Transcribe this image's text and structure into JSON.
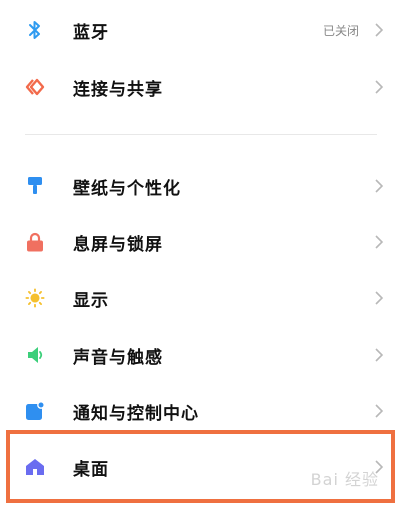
{
  "settings": {
    "bluetooth": {
      "label": "蓝牙",
      "value": "已关闭"
    },
    "connection": {
      "label": "连接与共享"
    },
    "wallpaper": {
      "label": "壁纸与个性化"
    },
    "lockscreen": {
      "label": "息屏与锁屏"
    },
    "display": {
      "label": "显示"
    },
    "sound": {
      "label": "声音与触感"
    },
    "notifications": {
      "label": "通知与控制中心"
    },
    "desktop": {
      "label": "桌面"
    }
  },
  "watermark": {
    "text": "Bai 经验"
  },
  "icons": {
    "bluetooth": "bluetooth-icon",
    "connection": "share-icon",
    "wallpaper": "paint-brush-icon",
    "lockscreen": "lock-icon",
    "display": "sun-icon",
    "sound": "speaker-icon",
    "notifications": "notification-icon",
    "desktop": "home-icon",
    "chevron": "chevron-right-icon"
  },
  "colors": {
    "bluetooth": "#2f9bf0",
    "connection": "#f26a4b",
    "wallpaper": "#2f8ff0",
    "lockscreen": "#f07060",
    "display": "#f5c02e",
    "sound": "#3ccf7a",
    "notifications": "#2f8ff0",
    "desktop": "#6a6cf0",
    "highlight": "#ef7040"
  }
}
